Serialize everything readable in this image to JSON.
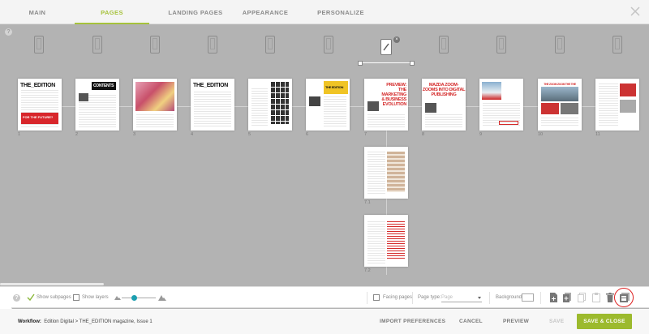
{
  "tabs": [
    {
      "label": "MAIN"
    },
    {
      "label": "PAGES"
    },
    {
      "label": "LANDING PAGES"
    },
    {
      "label": "APPEARANCE"
    },
    {
      "label": "PERSONALIZE"
    }
  ],
  "active_tab": "PAGES",
  "pages": [
    {
      "number": "1",
      "header": "THE_EDITION"
    },
    {
      "number": "2",
      "header": "CONTENTS"
    },
    {
      "number": "3",
      "header": ""
    },
    {
      "number": "4",
      "header": "THE_EDITION"
    },
    {
      "number": "5",
      "header": ""
    },
    {
      "number": "6",
      "header": "THE EDITION"
    },
    {
      "number": "7",
      "header": "PREVIEW: THE MARKETING & BUSINESS EVOLUTION"
    },
    {
      "number": "8",
      "header": "MAZDA ZOOM-ZOOMS INTO DIGITAL PUBLISHING"
    },
    {
      "number": "9",
      "header": ""
    },
    {
      "number": "10",
      "header": "THE ZOOM ZOOM THE THE"
    },
    {
      "number": "11",
      "header": ""
    }
  ],
  "subpages": [
    {
      "number": "7.1"
    },
    {
      "number": "7.2"
    }
  ],
  "page1_banner": "FOR THE FUTURE?",
  "toolbar": {
    "show_subpages": "Show subpages",
    "show_layers": "Show layers",
    "facing_pages": "Facing pages",
    "page_type_label": "Page type:",
    "page_type_value": "Page",
    "background_label": "Background:",
    "help": "?"
  },
  "footer": {
    "workflow_label": "Workflow:",
    "workflow_path": "Edition Digital  >  THE_EDITION magazine, Issue 1",
    "import_preferences": "IMPORT PREFERENCES",
    "cancel": "CANCEL",
    "preview": "PREVIEW",
    "save": "SAVE",
    "save_close": "SAVE & CLOSE"
  },
  "colors": {
    "accent": "#a6c23b",
    "save_close_bg": "#9cba2d",
    "slider": "#1c9fb0",
    "highlight_ring": "#dd2222",
    "magazine_red": "#d42a2a"
  }
}
